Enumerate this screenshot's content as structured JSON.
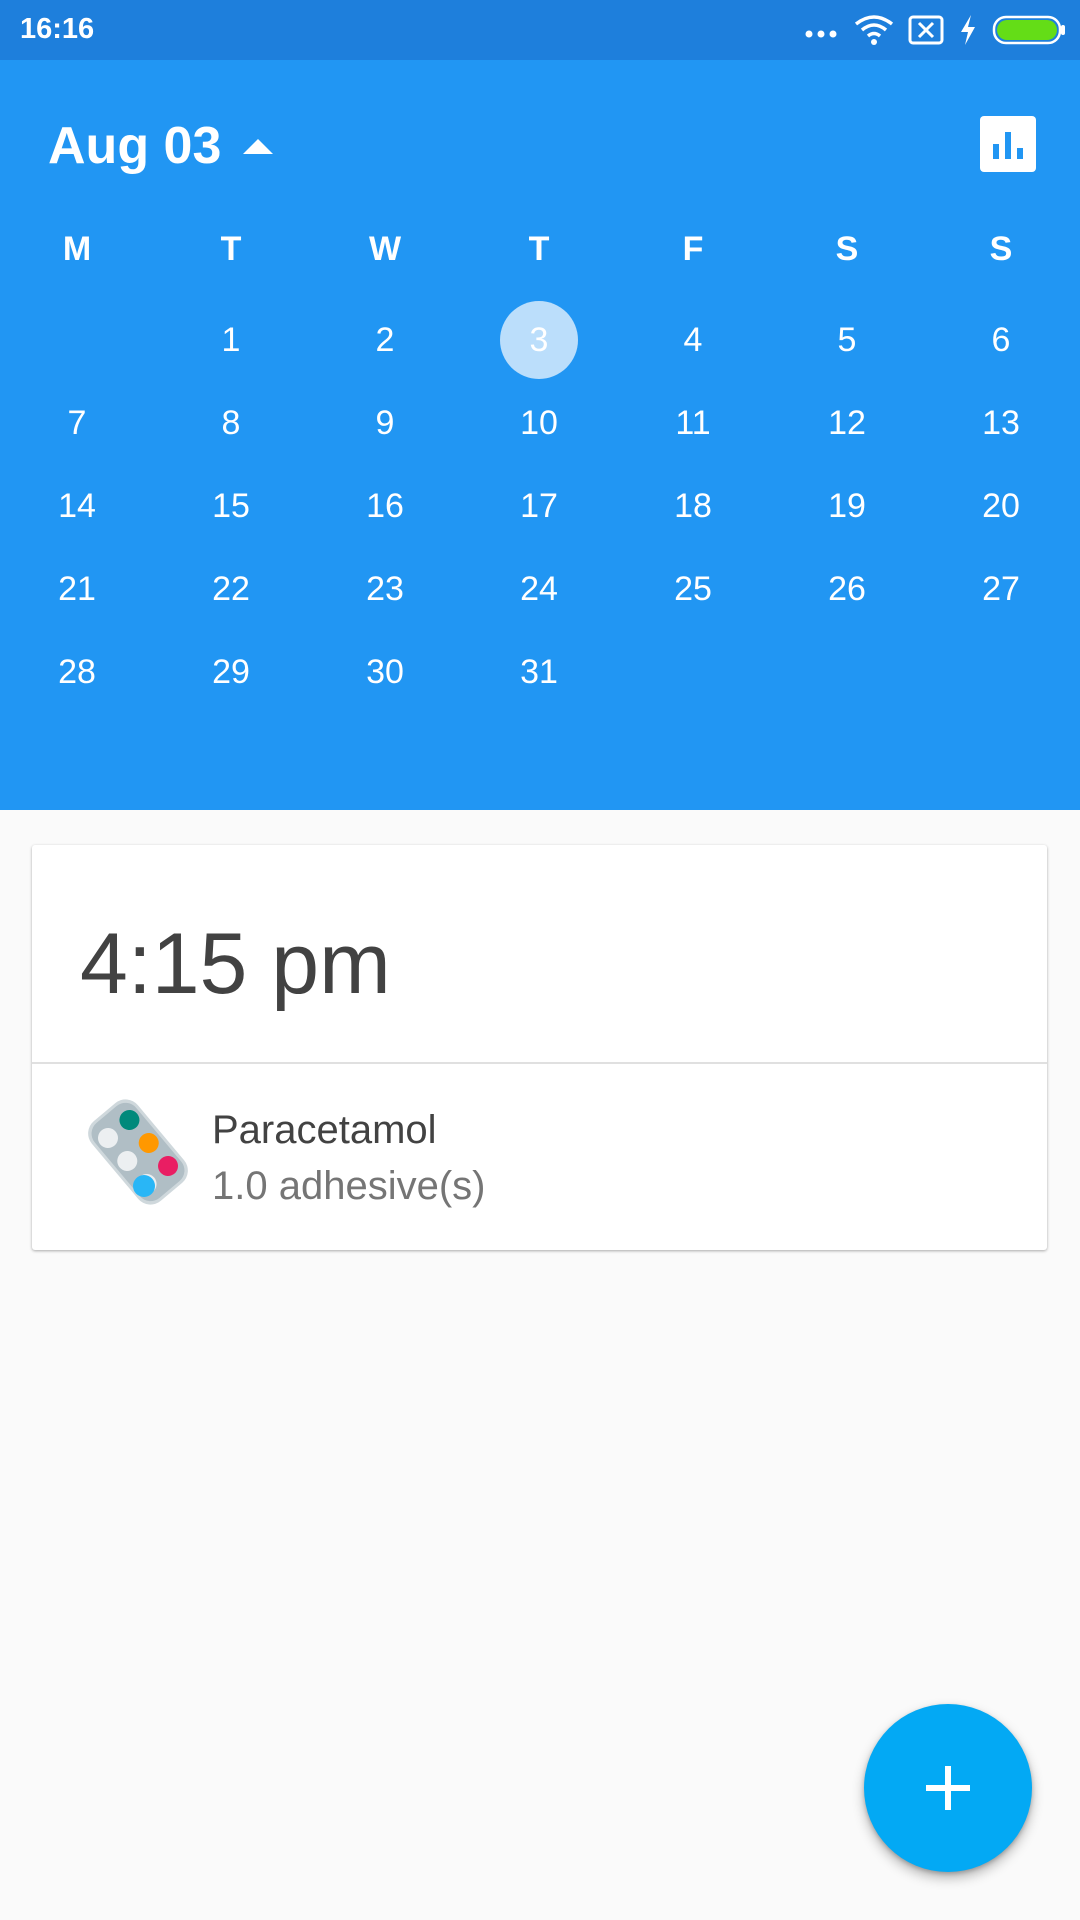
{
  "status_bar": {
    "time": "16:16",
    "icons": [
      "more-dots-icon",
      "wifi-icon",
      "sim-blocked-icon",
      "charging-bolt-icon",
      "battery-icon"
    ],
    "battery_color": "#64dd17"
  },
  "header": {
    "month_label": "Aug 03",
    "toggle_icon": "caret-up-icon",
    "action_icon": "bar-chart-icon",
    "background": "#2196f3"
  },
  "calendar": {
    "weekdays": [
      "M",
      "T",
      "W",
      "T",
      "F",
      "S",
      "S"
    ],
    "selected_day": "3",
    "weeks": [
      [
        "",
        "1",
        "2",
        "3",
        "4",
        "5",
        "6"
      ],
      [
        "7",
        "8",
        "9",
        "10",
        "11",
        "12",
        "13"
      ],
      [
        "14",
        "15",
        "16",
        "17",
        "18",
        "19",
        "20"
      ],
      [
        "21",
        "22",
        "23",
        "24",
        "25",
        "26",
        "27"
      ],
      [
        "28",
        "29",
        "30",
        "31",
        "",
        "",
        ""
      ]
    ]
  },
  "schedule_card": {
    "time": "4:15 pm",
    "medication": {
      "icon": "pill-blister-icon",
      "name": "Paracetamol",
      "dose": "1.0 adhesive(s)"
    }
  },
  "fab": {
    "icon": "plus-icon",
    "color": "#03a9f4"
  }
}
